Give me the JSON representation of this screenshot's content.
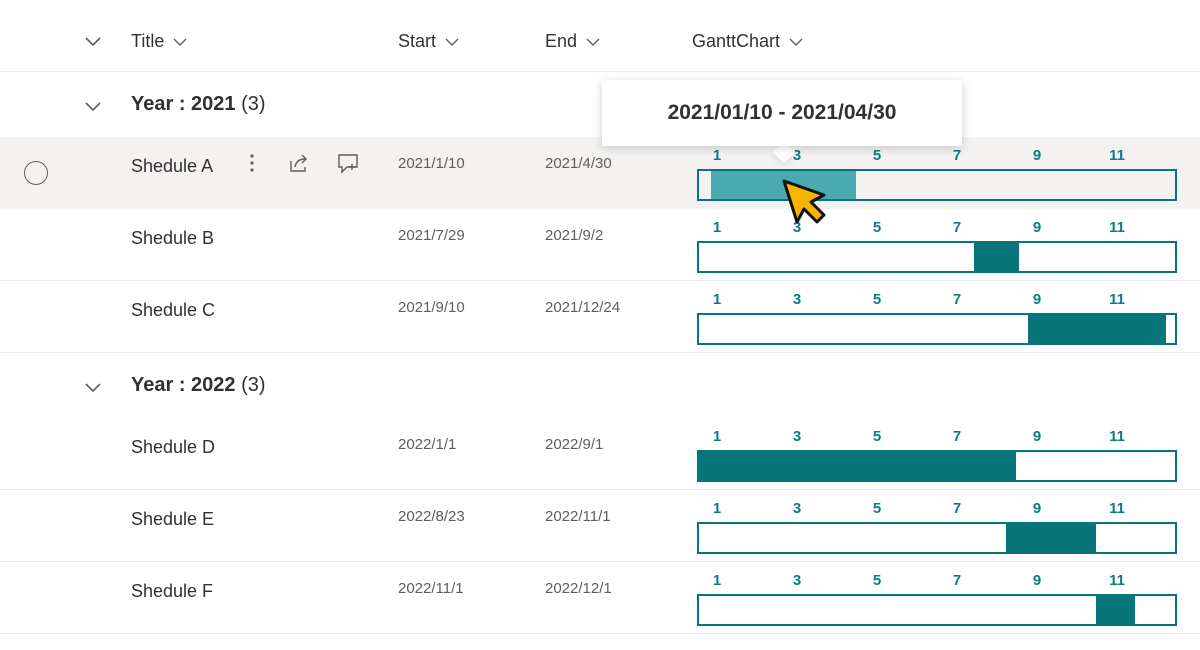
{
  "header": {
    "columns": [
      {
        "label": "Title"
      },
      {
        "label": "Start"
      },
      {
        "label": "End"
      },
      {
        "label": "GanttChart"
      }
    ]
  },
  "ticks": [
    "1",
    "3",
    "5",
    "7",
    "9",
    "11"
  ],
  "groups": [
    {
      "label": "Year : 2021",
      "count": "(3)",
      "rows": [
        {
          "title": "Shedule A",
          "start": "2021/1/10",
          "end": "2021/4/30",
          "bar_start_month": 1.3,
          "bar_end_month": 4.97,
          "selected": true
        },
        {
          "title": "Shedule B",
          "start": "2021/7/29",
          "end": "2021/9/2",
          "bar_start_month": 7.93,
          "bar_end_month": 9.07
        },
        {
          "title": "Shedule C",
          "start": "2021/9/10",
          "end": "2021/12/24",
          "bar_start_month": 9.3,
          "bar_end_month": 12.77
        }
      ]
    },
    {
      "label": "Year : 2022",
      "count": "(3)",
      "rows": [
        {
          "title": "Shedule D",
          "start": "2022/1/1",
          "end": "2022/9/1",
          "bar_start_month": 1.0,
          "bar_end_month": 9.0
        },
        {
          "title": "Shedule E",
          "start": "2022/8/23",
          "end": "2022/11/1",
          "bar_start_month": 8.73,
          "bar_end_month": 11.0
        },
        {
          "title": "Shedule F",
          "start": "2022/11/1",
          "end": "2022/12/1",
          "bar_start_month": 11.0,
          "bar_end_month": 12.0
        }
      ]
    }
  ],
  "tooltip": {
    "text": "2021/01/10 - 2021/04/30"
  },
  "colors": {
    "accent": "#077579",
    "selected_bar": "#4aaab0",
    "tick": "#0e7c80"
  }
}
